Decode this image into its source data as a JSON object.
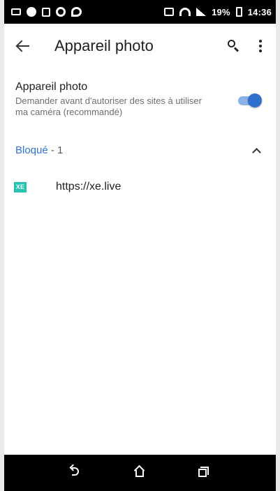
{
  "status_bar": {
    "left_icons": [
      "mail-icon",
      "record-icon",
      "document-icon",
      "sync-icon",
      "chat-icon"
    ],
    "right_icons": [
      "nfc-icon",
      "wifi-icon",
      "signal-icon",
      "battery-icon"
    ],
    "battery": "19%",
    "time": "14:36"
  },
  "app_bar": {
    "title": "Appareil photo",
    "back_icon": "back-arrow-icon",
    "search_icon": "search-icon",
    "more_icon": "more-vert-icon"
  },
  "setting": {
    "title": "Appareil photo",
    "description": "Demander avant d'autoriser des sites à utiliser ma caméra (recommandé)",
    "toggle_on": true,
    "accent_color": "#2f6fce"
  },
  "blocked_section": {
    "label": "Bloqué",
    "count": " - 1",
    "expanded": true
  },
  "sites": [
    {
      "favicon_text": "XE",
      "favicon_color": "#27c3b0",
      "url": "https://xe.live"
    }
  ],
  "nav_bar": {
    "buttons": [
      "back-icon",
      "home-icon",
      "recents-icon"
    ]
  }
}
